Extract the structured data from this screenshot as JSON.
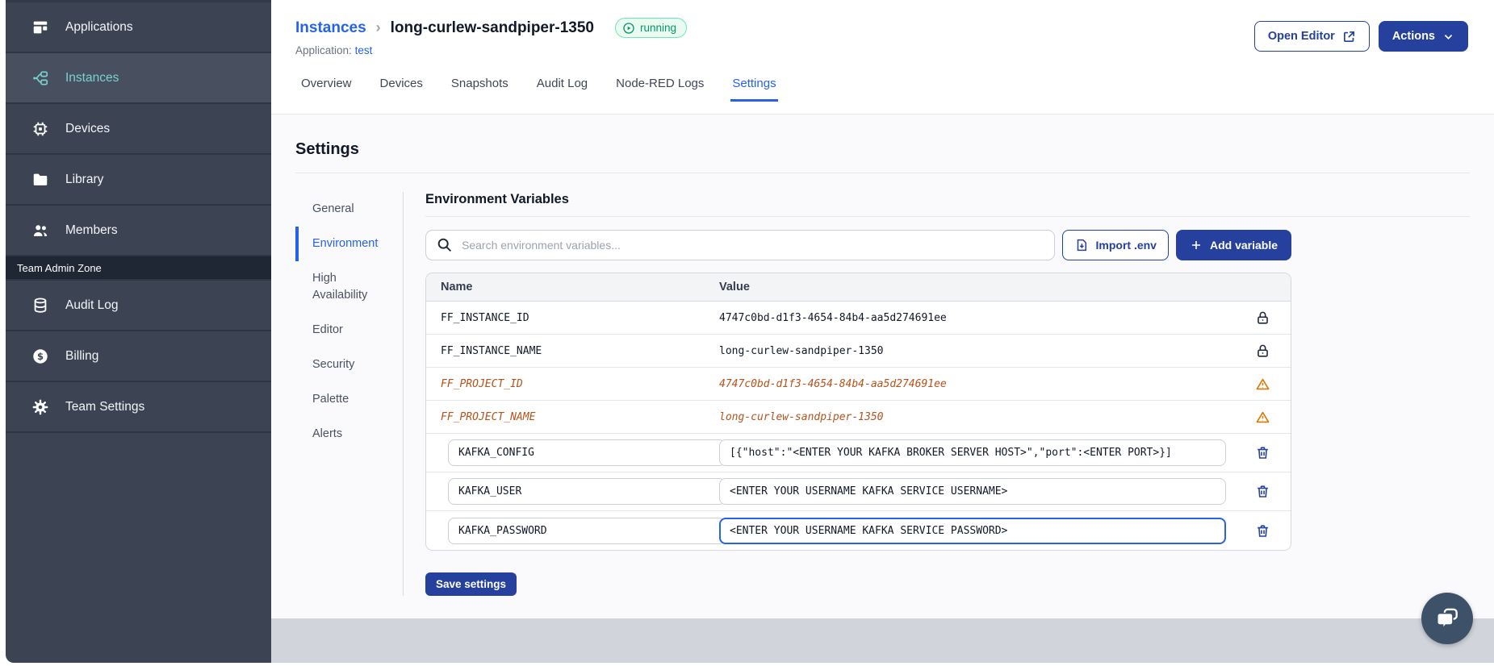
{
  "sidebar": {
    "items": [
      {
        "label": "Applications"
      },
      {
        "label": "Instances",
        "active": true
      },
      {
        "label": "Devices"
      },
      {
        "label": "Library"
      },
      {
        "label": "Members"
      }
    ],
    "admin_zone_label": "Team Admin Zone",
    "admin_items": [
      {
        "label": "Audit Log"
      },
      {
        "label": "Billing"
      },
      {
        "label": "Team Settings"
      }
    ]
  },
  "header": {
    "breadcrumb_parent": "Instances",
    "breadcrumb_separator": "›",
    "instance_name": "long-curlew-sandpiper-1350",
    "status_badge": "running",
    "application_label": "Application:",
    "application_name": "test",
    "open_editor_label": "Open Editor",
    "actions_label": "Actions"
  },
  "tabs": [
    {
      "label": "Overview"
    },
    {
      "label": "Devices"
    },
    {
      "label": "Snapshots"
    },
    {
      "label": "Audit Log"
    },
    {
      "label": "Node-RED Logs"
    },
    {
      "label": "Settings",
      "active": true
    }
  ],
  "settings": {
    "title": "Settings",
    "subnav": [
      {
        "label": "General"
      },
      {
        "label": "Environment",
        "active": true
      },
      {
        "label": "High Availability"
      },
      {
        "label": "Editor"
      },
      {
        "label": "Security"
      },
      {
        "label": "Palette"
      },
      {
        "label": "Alerts"
      }
    ]
  },
  "env_panel": {
    "title": "Environment Variables",
    "search_placeholder": "Search environment variables...",
    "import_label": "Import .env",
    "add_label": "Add variable",
    "save_label": "Save settings",
    "table": {
      "columns": [
        "Name",
        "Value"
      ],
      "rows": [
        {
          "name": "FF_INSTANCE_ID",
          "value": "4747c0bd-d1f3-4654-84b4-aa5d274691ee",
          "type": "locked"
        },
        {
          "name": "FF_INSTANCE_NAME",
          "value": "long-curlew-sandpiper-1350",
          "type": "locked"
        },
        {
          "name": "FF_PROJECT_ID",
          "value": "4747c0bd-d1f3-4654-84b4-aa5d274691ee",
          "type": "deprecated"
        },
        {
          "name": "FF_PROJECT_NAME",
          "value": "long-curlew-sandpiper-1350",
          "type": "deprecated"
        },
        {
          "name": "KAFKA_CONFIG",
          "value": "[{\"host\":\"<ENTER YOUR KAFKA BROKER SERVER HOST>\",\"port\":<ENTER PORT>}]",
          "type": "editable"
        },
        {
          "name": "KAFKA_USER",
          "value": "<ENTER YOUR USERNAME KAFKA SERVICE USERNAME>",
          "type": "editable"
        },
        {
          "name": "KAFKA_PASSWORD",
          "value": "<ENTER YOUR USERNAME KAFKA SERVICE PASSWORD>",
          "type": "editable",
          "focused": true
        }
      ]
    }
  },
  "colors": {
    "primary_blue": "#25419D",
    "link_blue": "#2563EB",
    "sidebar_bg": "#3C4454",
    "sidebar_active_teal": "#79D2CF",
    "status_green": "#059669",
    "warning_orange": "#D97706",
    "deprecated_text": "#B4531B",
    "footer_gray": "#D1D4DB"
  }
}
